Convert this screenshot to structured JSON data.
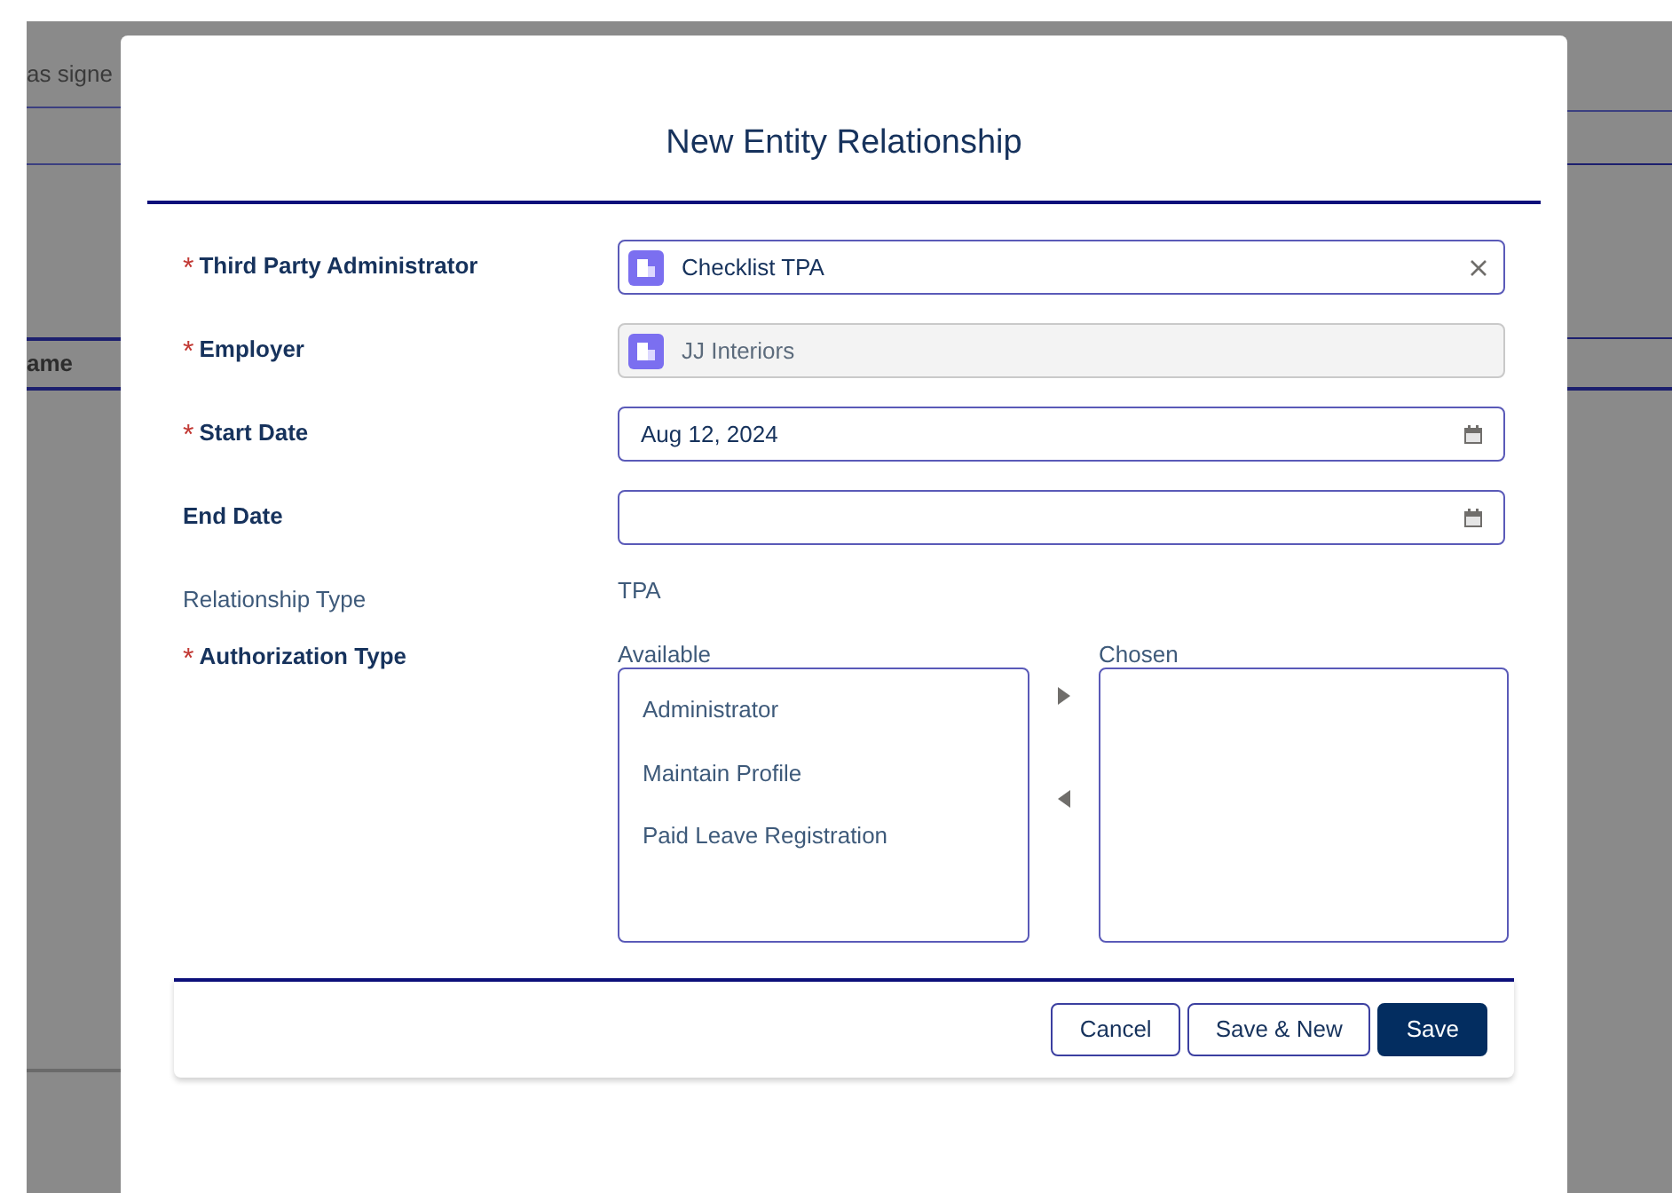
{
  "background": {
    "texts": [
      "as signe",
      "ame"
    ]
  },
  "modal": {
    "title": "New Entity Relationship",
    "fields": [
      {
        "kind": "lookup",
        "marker": "*",
        "label": "Third Party Administrator",
        "value": "Checklist TPA"
      },
      {
        "kind": "locked_lookup",
        "marker": "*",
        "label": "Employer",
        "value": "JJ Interiors"
      },
      {
        "kind": "date",
        "marker": "*",
        "label": "Start Date",
        "value": "Aug 12, 2024"
      },
      {
        "kind": "date",
        "label": "End Date"
      },
      {
        "kind": "readonly",
        "label": "Relationship Type",
        "value": "TPA"
      }
    ],
    "dual_list": {
      "marker": "*",
      "label": "Authorization Type",
      "available_label": "Available",
      "chosen_label": "Chosen",
      "available": [
        "Administrator",
        "Maintain Profile",
        "Paid Leave Registration"
      ]
    },
    "buttons": [
      {
        "label": "Cancel",
        "kind": "neutral"
      },
      {
        "label": "Save & New",
        "kind": "neutral"
      },
      {
        "label": "Save",
        "kind": "brand"
      }
    ]
  }
}
